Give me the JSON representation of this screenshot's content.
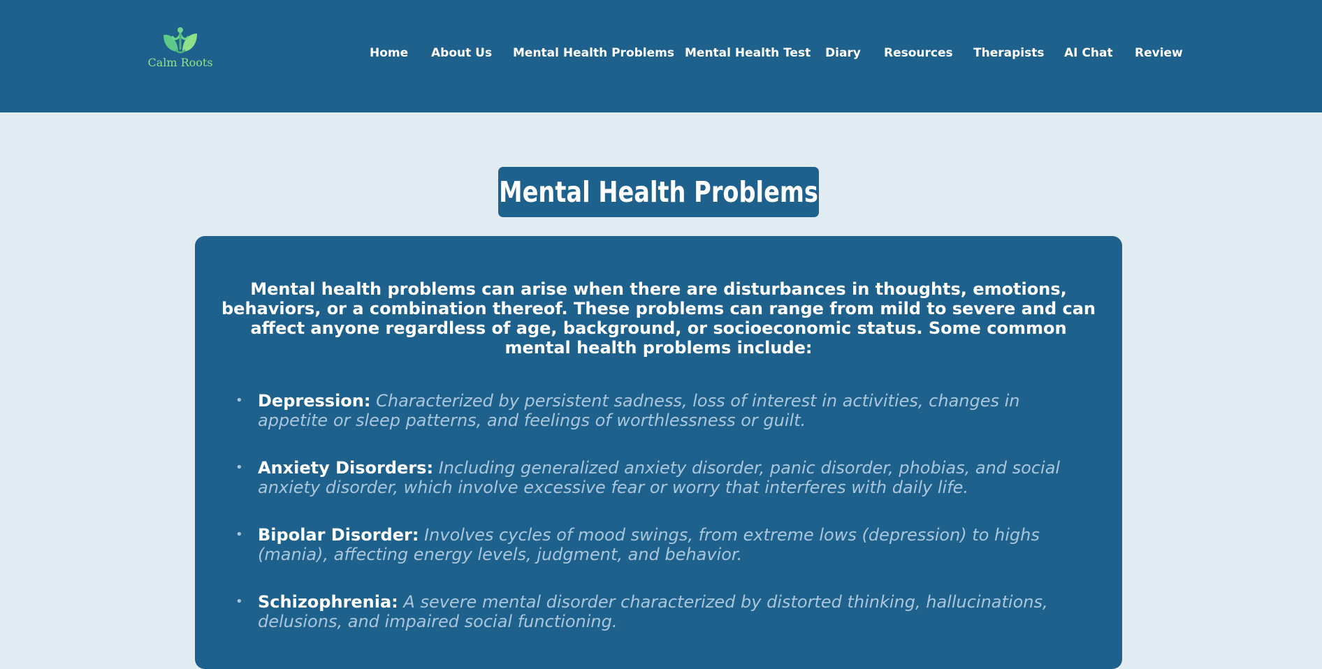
{
  "brand": {
    "name": "Calm Roots",
    "logo_icon": "leaf-person-icon",
    "colors": {
      "header_bg": "#1f618d",
      "page_bg": "#e0ecf1",
      "logo_green": "#8fe28a",
      "description_text": "#a9c6da"
    }
  },
  "nav": {
    "items": [
      {
        "label": "Home"
      },
      {
        "label": "About Us"
      },
      {
        "label": "Mental Health Problems"
      },
      {
        "label": "Mental Health Test"
      },
      {
        "label": "Diary"
      },
      {
        "label": "Resources"
      },
      {
        "label": "Therapists"
      },
      {
        "label": "AI Chat"
      },
      {
        "label": "Review"
      }
    ]
  },
  "main": {
    "title": "Mental Health Problems",
    "intro": "Mental health problems can arise when there are disturbances in thoughts, emotions, behaviors, or a combination thereof. These problems can range from mild to severe and can affect anyone regardless of age, background, or socioeconomic status. Some common mental health problems include:",
    "problems": [
      {
        "term": "Depression:",
        "description": "Characterized by persistent sadness, loss of interest in activities, changes in appetite or sleep patterns, and feelings of worthlessness or guilt."
      },
      {
        "term": "Anxiety Disorders:",
        "description": "Including generalized anxiety disorder, panic disorder, phobias, and social anxiety disorder, which involve excessive fear or worry that interferes with daily life."
      },
      {
        "term": "Bipolar Disorder:",
        "description": "Involves cycles of mood swings, from extreme lows (depression) to highs (mania), affecting energy levels, judgment, and behavior."
      },
      {
        "term": "Schizophrenia:",
        "description": "A severe mental disorder characterized by distorted thinking, hallucinations, delusions, and impaired social functioning."
      }
    ]
  }
}
